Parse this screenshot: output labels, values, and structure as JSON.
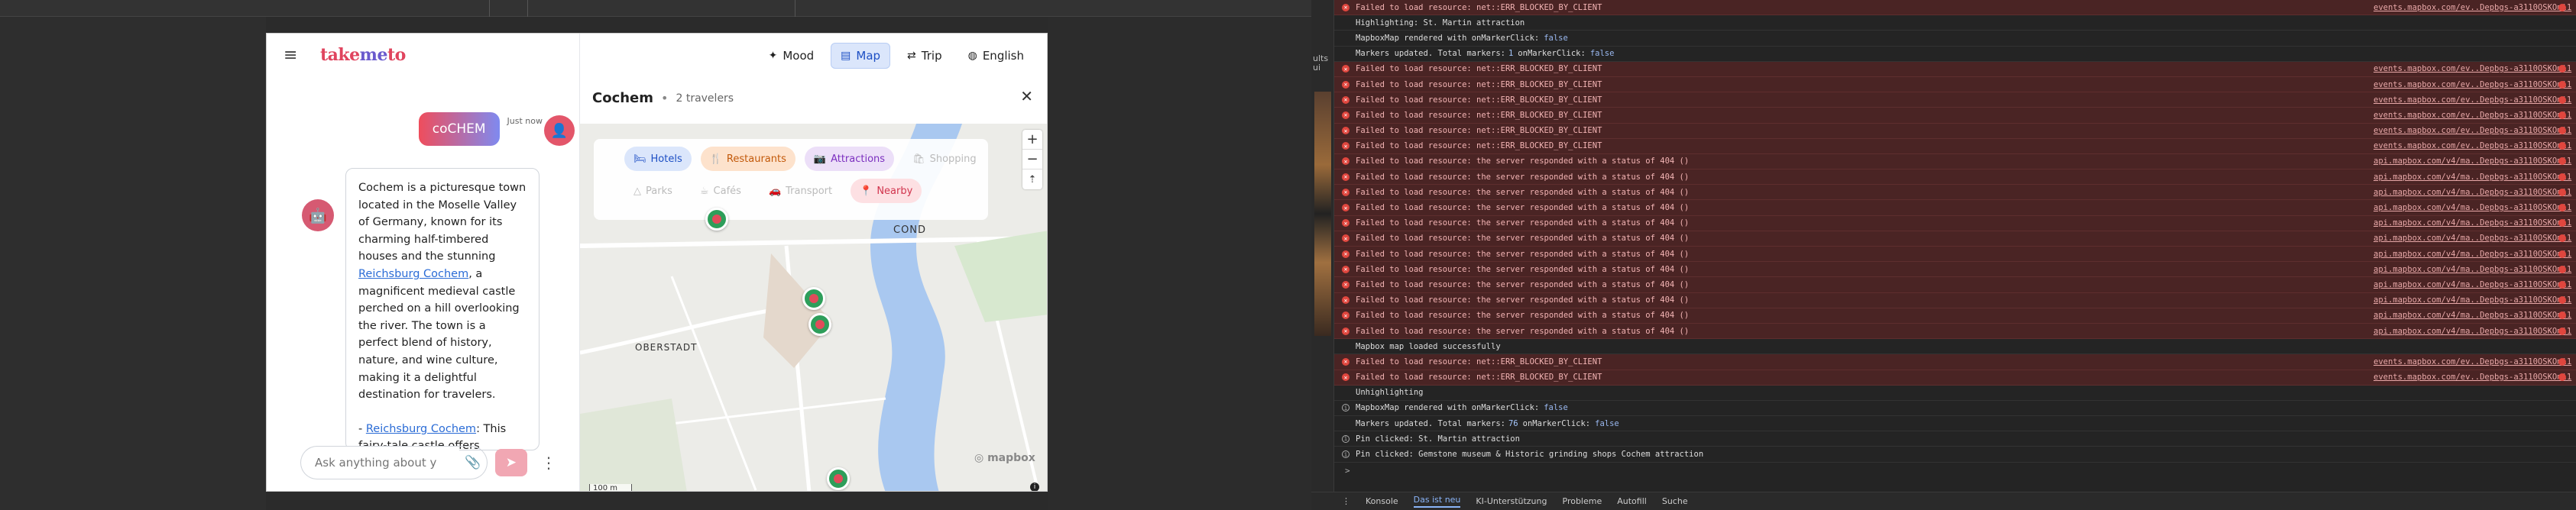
{
  "app": {
    "logo": {
      "part1": "take",
      "part2": "me",
      "part3": "to"
    },
    "nav": [
      {
        "label": "Mood",
        "icon": "sparkle-icon"
      },
      {
        "label": "Map",
        "icon": "map-icon"
      },
      {
        "label": "Trip",
        "icon": "route-icon"
      },
      {
        "label": "English",
        "icon": "globe-icon"
      }
    ]
  },
  "chat": {
    "user_message": "coCHEM",
    "timestamp": "Just now",
    "bot_paragraph1_pre": "Cochem is a picturesque town located in the Moselle Valley of Germany, known for its charming half-timbered houses and the stunning ",
    "bot_link1": "Reichsburg Cochem",
    "bot_paragraph1_post": ", a magnificent medieval castle perched on a hill overlooking the river. The town is a perfect blend of history, nature, and wine culture, making it a delightful destination for travelers.",
    "bot_bullet_prefix": "- ",
    "bot_link2": "Reichsburg Cochem",
    "bot_bullet_text": ": This fairy-tale castle offers breathtaking",
    "input_placeholder": "Ask anything about y"
  },
  "map": {
    "city": "Cochem",
    "separator": "•",
    "travelers": "2 travelers",
    "filters_row1": [
      {
        "label": "Hotels",
        "state": "hotels"
      },
      {
        "label": "Restaurants",
        "state": "rest"
      },
      {
        "label": "Attractions",
        "state": "attr"
      },
      {
        "label": "Shopping",
        "state": "off"
      }
    ],
    "filters_row2": [
      {
        "label": "Parks",
        "state": "off"
      },
      {
        "label": "Cafés",
        "state": "off"
      },
      {
        "label": "Transport",
        "state": "off"
      },
      {
        "label": "Nearby",
        "state": "near"
      }
    ],
    "labels": {
      "cond": "COND",
      "oberstadt": "OBERSTADT"
    },
    "attribution": "mapbox",
    "scale": "100 m",
    "zoom_in": "+",
    "zoom_out": "−",
    "compass": "⇡"
  },
  "devtools": {
    "log": [
      {
        "t": "err",
        "text": "Failed to load resource: net::ERR_BLOCKED_BY_CLIENT",
        "src": "events.mapbox.com/ev..Depbgs-a3110OSKOmi1"
      },
      {
        "t": "plain",
        "text": "Highlighting: St. Martin attraction"
      },
      {
        "t": "plain",
        "text": "MapboxMap rendered with onMarkerClick:",
        "bool": "false"
      },
      {
        "t": "plain",
        "text": "Markers updated. Total markers:",
        "num": "1",
        "text2": "onMarkerClick:",
        "bool": "false"
      },
      {
        "t": "err",
        "text": "Failed to load resource: net::ERR_BLOCKED_BY_CLIENT",
        "src": "events.mapbox.com/ev..Depbgs-a3110OSKOmi1"
      },
      {
        "t": "err",
        "text": "Failed to load resource: net::ERR_BLOCKED_BY_CLIENT",
        "src": "events.mapbox.com/ev..Depbgs-a3110OSKOmi1"
      },
      {
        "t": "err",
        "text": "Failed to load resource: net::ERR_BLOCKED_BY_CLIENT",
        "src": "events.mapbox.com/ev..Depbgs-a3110OSKOmi1"
      },
      {
        "t": "err",
        "text": "Failed to load resource: net::ERR_BLOCKED_BY_CLIENT",
        "src": "events.mapbox.com/ev..Depbgs-a3110OSKOmi1"
      },
      {
        "t": "err",
        "text": "Failed to load resource: net::ERR_BLOCKED_BY_CLIENT",
        "src": "events.mapbox.com/ev..Depbgs-a3110OSKOmi1"
      },
      {
        "t": "err",
        "text": "Failed to load resource: net::ERR_BLOCKED_BY_CLIENT",
        "src": "events.mapbox.com/ev..Depbgs-a3110OSKOmi1"
      },
      {
        "t": "err",
        "text": "Failed to load resource: the server responded with a status of 404 ()",
        "src": "api.mapbox.com/v4/ma..Depbgs-a3110OSKOmi1"
      },
      {
        "t": "err",
        "text": "Failed to load resource: the server responded with a status of 404 ()",
        "src": "api.mapbox.com/v4/ma..Depbgs-a3110OSKOmi1"
      },
      {
        "t": "err",
        "text": "Failed to load resource: the server responded with a status of 404 ()",
        "src": "api.mapbox.com/v4/ma..Depbgs-a3110OSKOmi1"
      },
      {
        "t": "err",
        "text": "Failed to load resource: the server responded with a status of 404 ()",
        "src": "api.mapbox.com/v4/ma..Depbgs-a3110OSKOmi1"
      },
      {
        "t": "err",
        "text": "Failed to load resource: the server responded with a status of 404 ()",
        "src": "api.mapbox.com/v4/ma..Depbgs-a3110OSKOmi1"
      },
      {
        "t": "err",
        "text": "Failed to load resource: the server responded with a status of 404 ()",
        "src": "api.mapbox.com/v4/ma..Depbgs-a3110OSKOmi1"
      },
      {
        "t": "err",
        "text": "Failed to load resource: the server responded with a status of 404 ()",
        "src": "api.mapbox.com/v4/ma..Depbgs-a3110OSKOmi1"
      },
      {
        "t": "err",
        "text": "Failed to load resource: the server responded with a status of 404 ()",
        "src": "api.mapbox.com/v4/ma..Depbgs-a3110OSKOmi1"
      },
      {
        "t": "err",
        "text": "Failed to load resource: the server responded with a status of 404 ()",
        "src": "api.mapbox.com/v4/ma..Depbgs-a3110OSKOmi1"
      },
      {
        "t": "err",
        "text": "Failed to load resource: the server responded with a status of 404 ()",
        "src": "api.mapbox.com/v4/ma..Depbgs-a3110OSKOmi1"
      },
      {
        "t": "err",
        "text": "Failed to load resource: the server responded with a status of 404 ()",
        "src": "api.mapbox.com/v4/ma..Depbgs-a3110OSKOmi1"
      },
      {
        "t": "err",
        "text": "Failed to load resource: the server responded with a status of 404 ()",
        "src": "api.mapbox.com/v4/ma..Depbgs-a3110OSKOmi1"
      },
      {
        "t": "plain",
        "text": "Mapbox map loaded successfully"
      },
      {
        "t": "err",
        "text": "Failed to load resource: net::ERR_BLOCKED_BY_CLIENT",
        "src": "events.mapbox.com/ev..Depbgs-a3110OSKOmi1"
      },
      {
        "t": "err",
        "text": "Failed to load resource: net::ERR_BLOCKED_BY_CLIENT",
        "src": "events.mapbox.com/ev..Depbgs-a3110OSKOmi1"
      },
      {
        "t": "plain",
        "text": "Unhighlighting"
      },
      {
        "t": "info",
        "text": "MapboxMap rendered with onMarkerClick:",
        "bool": "false"
      },
      {
        "t": "plain",
        "text": "Markers updated. Total markers:",
        "num": "76",
        "text2": "onMarkerClick:",
        "bool": "false"
      },
      {
        "t": "info",
        "text": "Pin clicked: St. Martin attraction"
      },
      {
        "t": "info",
        "text": "Pin clicked: Gemstone museum & Historic grinding shops Cochem attraction"
      }
    ],
    "prompt": ">",
    "tabs": [
      "Konsole",
      "Das ist neu",
      "KI-Unterstützung",
      "Probleme",
      "Autofill",
      "Suche"
    ],
    "active_tab": "Das ist neu",
    "side_labels": [
      "ults",
      "ui"
    ]
  }
}
